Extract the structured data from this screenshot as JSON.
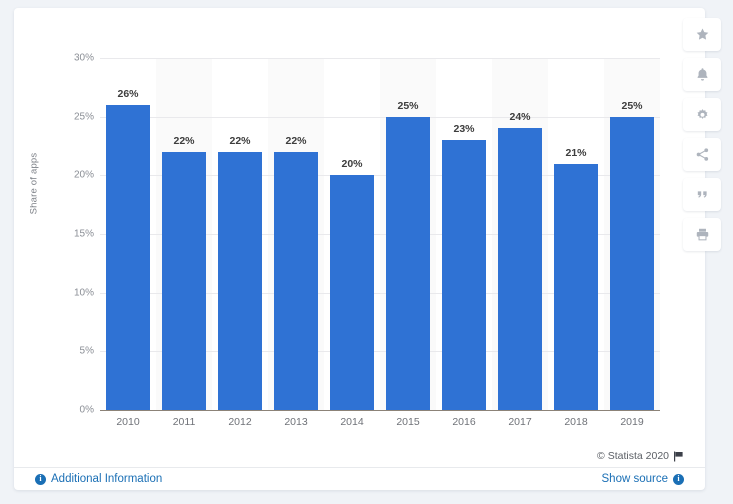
{
  "chart_data": {
    "type": "bar",
    "title": "",
    "xlabel": "",
    "ylabel": "Share of apps",
    "categories": [
      "2010",
      "2011",
      "2012",
      "2013",
      "2014",
      "2015",
      "2016",
      "2017",
      "2018",
      "2019"
    ],
    "values": [
      26,
      22,
      22,
      22,
      20,
      25,
      23,
      24,
      21,
      25
    ],
    "data_labels": [
      "26%",
      "22%",
      "22%",
      "22%",
      "20%",
      "25%",
      "23%",
      "24%",
      "21%",
      "25%"
    ],
    "ylim": [
      0,
      30
    ],
    "y_ticks": [
      0,
      5,
      10,
      15,
      20,
      25,
      30
    ],
    "y_tick_labels": [
      "0%",
      "5%",
      "10%",
      "15%",
      "20%",
      "25%",
      "30%"
    ],
    "grid": true,
    "legend": false,
    "bar_color": "#2f72d4",
    "band_color": "#fafafa"
  },
  "footer": {
    "copyright": "© Statista 2020",
    "flag_icon": "flag-icon",
    "additional_information": "Additional Information",
    "show_source": "Show source",
    "info_glyph": "i"
  },
  "action_rail": [
    {
      "name": "favorite-button",
      "icon": "star-icon"
    },
    {
      "name": "alerts-button",
      "icon": "bell-icon"
    },
    {
      "name": "settings-button",
      "icon": "gear-icon"
    },
    {
      "name": "share-button",
      "icon": "share-icon"
    },
    {
      "name": "cite-button",
      "icon": "quote-icon"
    },
    {
      "name": "print-button",
      "icon": "print-icon"
    }
  ]
}
